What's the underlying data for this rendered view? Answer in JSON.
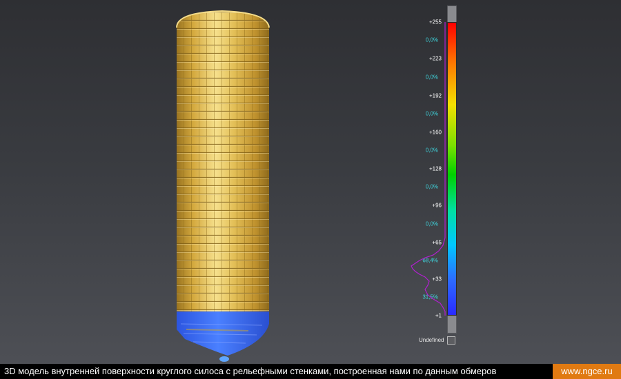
{
  "colors": {
    "accent_orange": "#e07a12",
    "silo_gold": "#e4c15a",
    "silo_blue": "#3d6dff",
    "pct_cyan": "#3fd8e0",
    "histogram_magenta": "#b21fd0"
  },
  "scale": {
    "ticks": [
      "+255",
      "+223",
      "+192",
      "+160",
      "+128",
      "+96",
      "+65",
      "+33",
      "+1"
    ],
    "percentages": [
      "0,0%",
      "0,0%",
      "0,0%",
      "0,0%",
      "0,0%",
      "0,0%",
      "68,4%",
      "31,5%"
    ],
    "undefined_label": "Undefined"
  },
  "footer": {
    "caption": "3D модель внутренней поверхности круглого силоса с рельефными стенками, построенная нами по данным обмеров",
    "site": "www.ngce.ru"
  }
}
